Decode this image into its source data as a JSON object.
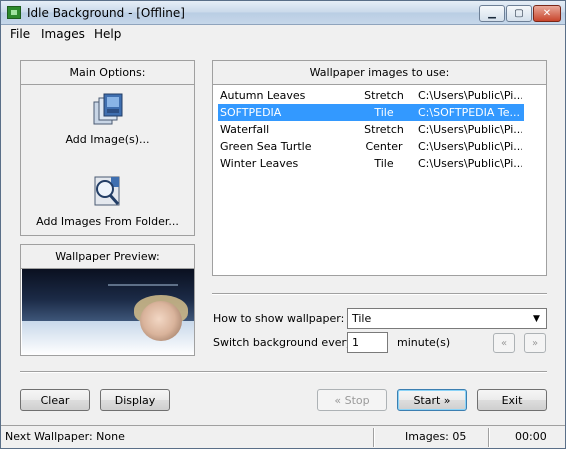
{
  "window": {
    "title": "Idle Background - [Offline]"
  },
  "menu": {
    "items": [
      "File",
      "Images",
      "Help"
    ]
  },
  "main_options": {
    "header": "Main Options:",
    "add_images_label": "Add Image(s)...",
    "add_folder_label": "Add Images From Folder..."
  },
  "preview": {
    "header": "Wallpaper Preview:"
  },
  "wallpaper_list": {
    "header": "Wallpaper images to use:",
    "rows": [
      {
        "name": "Autumn Leaves",
        "mode": "Stretch",
        "path": "C:\\Users\\Public\\Pi...",
        "selected": false
      },
      {
        "name": "SOFTPEDIA",
        "mode": "Tile",
        "path": "C:\\SOFTPEDIA Te...",
        "selected": true
      },
      {
        "name": "Waterfall",
        "mode": "Stretch",
        "path": "C:\\Users\\Public\\Pi...",
        "selected": false
      },
      {
        "name": "Green Sea Turtle",
        "mode": "Center",
        "path": "C:\\Users\\Public\\Pi...",
        "selected": false
      },
      {
        "name": "Winter Leaves",
        "mode": "Tile",
        "path": "C:\\Users\\Public\\Pi...",
        "selected": false
      }
    ]
  },
  "settings": {
    "how_label": "How to show wallpaper:",
    "how_value": "Tile",
    "switch_label": "Switch background every",
    "switch_value": "1",
    "switch_unit": "minute(s)",
    "prev_symbol": "«",
    "next_symbol": "»"
  },
  "buttons": {
    "clear": "Clear",
    "display": "Display",
    "stop": "« Stop",
    "start": "Start »",
    "exit": "Exit"
  },
  "status": {
    "next_wallpaper": "Next Wallpaper:  None",
    "images": "Images:  05",
    "time": "00:00"
  }
}
